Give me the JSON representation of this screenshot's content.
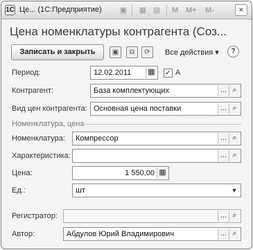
{
  "window": {
    "title": "Це... (1С:Предприятие)",
    "app_icon": "1C",
    "toolbar_icons": [
      "save-icon",
      "calculator-icon",
      "calendar-icon"
    ],
    "memory_buttons": [
      "M",
      "M+",
      "M-"
    ],
    "close_glyph": "×"
  },
  "form": {
    "title": "Цена номенклатуры контрагента (Соз..."
  },
  "commandbar": {
    "save_close": "Записать и закрыть",
    "all_actions": "Все действия ▾",
    "help": "?"
  },
  "fields": {
    "period_label": "Период:",
    "period_value": "12.02.2011",
    "period_flag_label": "А",
    "period_flag_checked": true,
    "contractor_label": "Контрагент:",
    "contractor_value": "База комплектующих",
    "price_type_label": "Вид цен контрагента:",
    "price_type_value": "Основная цена поставки",
    "group_title": "Номенклатура, цена",
    "nomenclature_label": "Номенклатура:",
    "nomenclature_value": "Компрессор",
    "characteristic_label": "Характеристика:",
    "characteristic_value": "",
    "price_label": "Цена:",
    "price_value": "1 550,00",
    "unit_label": "Ед.:",
    "unit_value": "шт",
    "registrar_label": "Регистратор:",
    "registrar_value": "",
    "author_label": "Автор:",
    "author_value": "Абдулов Юрий Владимирович"
  },
  "glyphs": {
    "ellipsis": "...",
    "search": "🔍",
    "check": "✓",
    "dropdown": "▼",
    "calendar": "▦",
    "calculator": "▦"
  }
}
